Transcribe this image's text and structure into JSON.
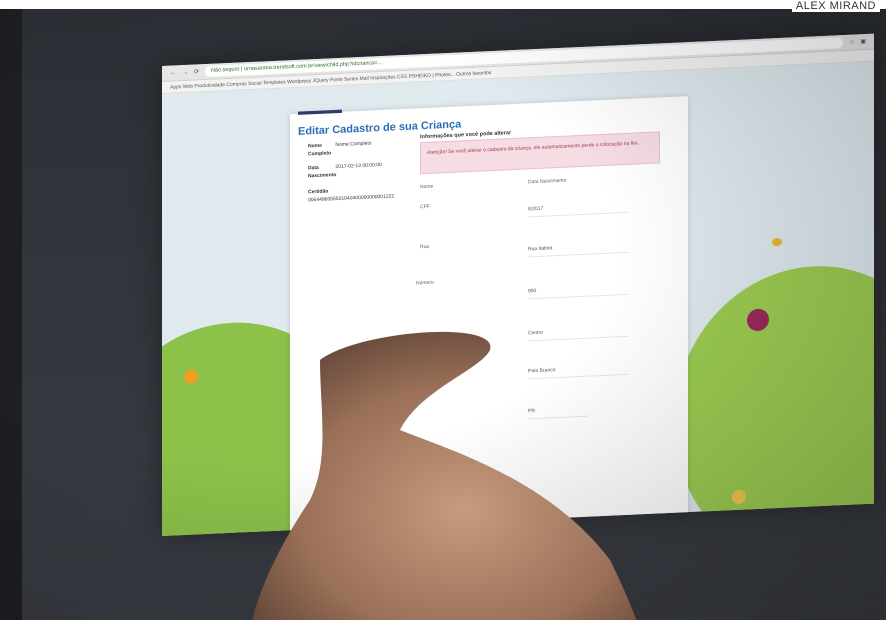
{
  "credit": "ALEX MIRAND",
  "browser": {
    "address": "Não seguro | urnasarana.trendsoft.com.br/view/child.php?idcrianca=...",
    "bookmarks": "Apps   Web   Produtividade   Compras   Social   Templates   Wordpress   JQuery   Fonts   Series   Mail   Inspirações   CSS   PSHEIKO | Photos...   Outros favoritos"
  },
  "page": {
    "title": "Editar Cadastro de sua Criança",
    "left": {
      "nome_label": "Nome",
      "nome_value": "Nome Completo",
      "completo_label": "Completo",
      "data_label": "Data",
      "data_value": "2017-02-13 00:00:00",
      "nascimento_label": "Nascimento",
      "certidao_label": "Certidão",
      "certidao_value": "0064496055501040400000000001222"
    },
    "right": {
      "section_title": "Informações que você pode alterar",
      "alert": "Atenção! Se você alterar o cadastro da criança, ele automaticamente perde a colocação na fila...",
      "nome_label": "Nome",
      "data_nascimento_label": "Data Nascimento",
      "cpf_label": "CPF",
      "data_value": "8/2017",
      "rua_label": "Rua",
      "rua_value": "Rua Itabira",
      "numero_label": "Número",
      "numero_value": "900",
      "bairro_value": "Centro",
      "cidade_value": "Pato Branco",
      "uf_value": "PR"
    }
  }
}
